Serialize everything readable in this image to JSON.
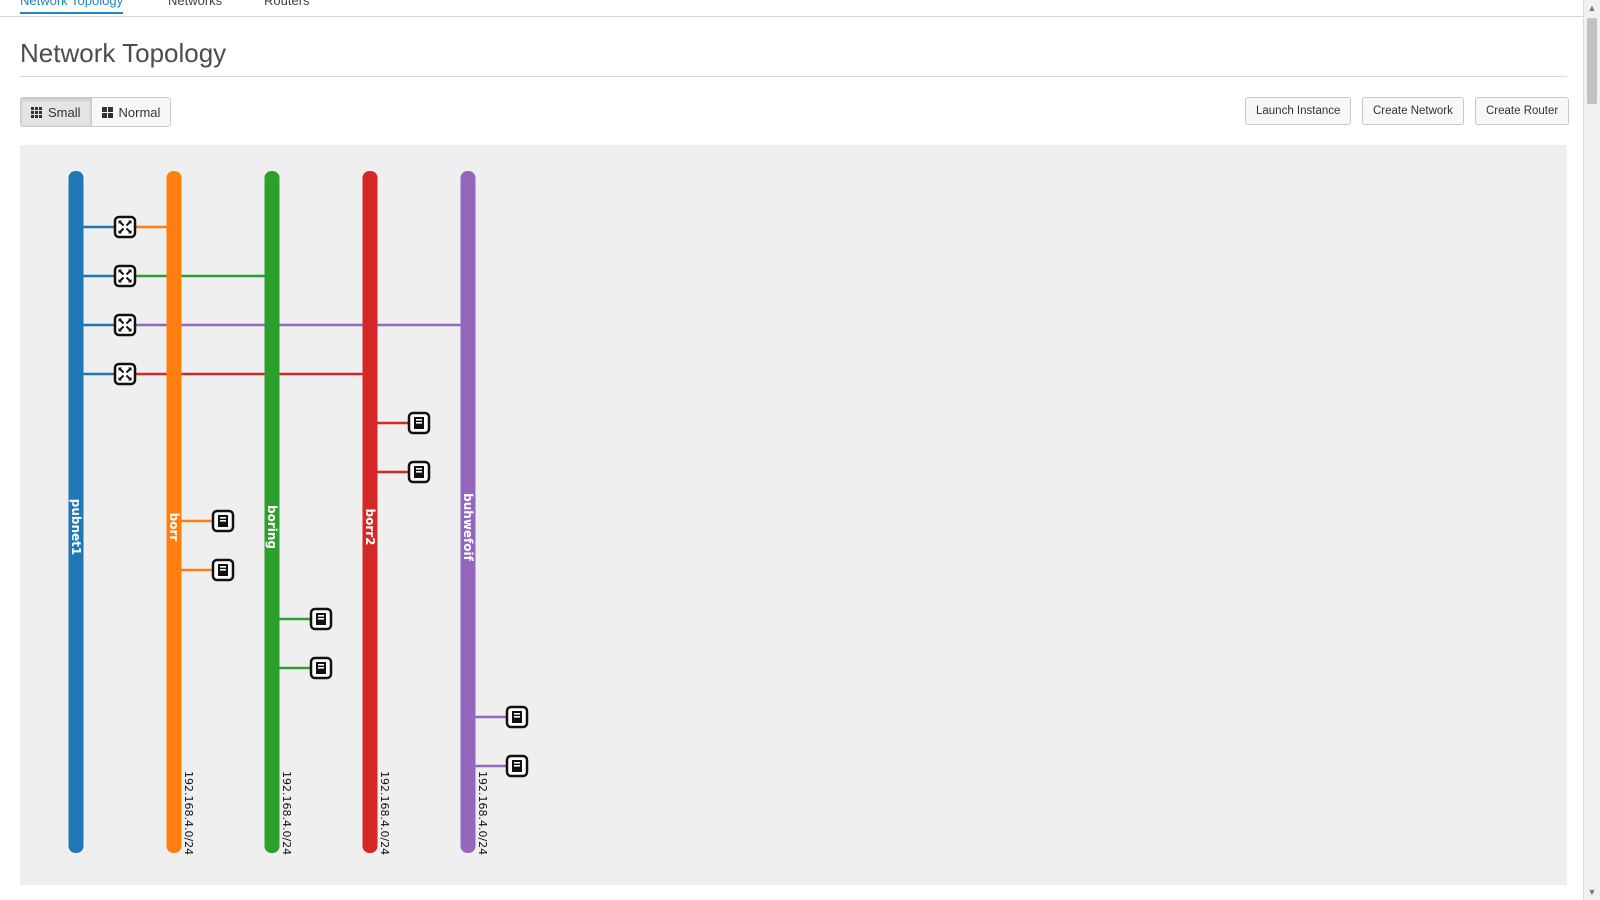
{
  "tabs": [
    {
      "label": "Network Topology",
      "active": true
    },
    {
      "label": "Networks",
      "active": false
    },
    {
      "label": "Routers",
      "active": false
    }
  ],
  "page_title": "Network Topology",
  "view_toggle": {
    "small": "Small",
    "normal": "Normal",
    "selected": "Small"
  },
  "actions": {
    "launch_instance": "Launch Instance",
    "create_network": "Create Network",
    "create_router": "Create Router"
  },
  "colors": {
    "pubnet1": "#1f77b4",
    "borr": "#ff7f0e",
    "boring": "#2ca02c",
    "borr2": "#d62728",
    "buhwefoif": "#9467bd",
    "canvas_bg": "#efefef",
    "tab_active": "#1f86c7"
  },
  "topology": {
    "networks": [
      {
        "id": "pubnet1",
        "name": "pubnet1",
        "cidr": "",
        "color": "#1f77b4"
      },
      {
        "id": "borr",
        "name": "borr",
        "cidr": "192.168.4.0/24",
        "color": "#ff7f0e"
      },
      {
        "id": "boring",
        "name": "boring",
        "cidr": "192.168.4.0/24",
        "color": "#2ca02c"
      },
      {
        "id": "borr2",
        "name": "borr2",
        "cidr": "192.168.4.0/24",
        "color": "#d62728"
      },
      {
        "id": "buhwefoif",
        "name": "buhwefoif",
        "cidr": "192.168.4.0/24",
        "color": "#9467bd"
      }
    ],
    "routers": [
      {
        "icon": "router-icon",
        "external": "pubnet1",
        "internal": "borr"
      },
      {
        "icon": "router-icon",
        "external": "pubnet1",
        "internal": "boring"
      },
      {
        "icon": "router-icon",
        "external": "pubnet1",
        "internal": "buhwefoif"
      },
      {
        "icon": "router-icon",
        "external": "pubnet1",
        "internal": "borr2"
      }
    ],
    "instances": [
      {
        "icon": "instance-icon",
        "network": "borr2"
      },
      {
        "icon": "instance-icon",
        "network": "borr2"
      },
      {
        "icon": "instance-icon",
        "network": "borr"
      },
      {
        "icon": "instance-icon",
        "network": "borr"
      },
      {
        "icon": "instance-icon",
        "network": "boring"
      },
      {
        "icon": "instance-icon",
        "network": "boring"
      },
      {
        "icon": "instance-icon",
        "network": "buhwefoif"
      },
      {
        "icon": "instance-icon",
        "network": "buhwefoif"
      }
    ]
  }
}
